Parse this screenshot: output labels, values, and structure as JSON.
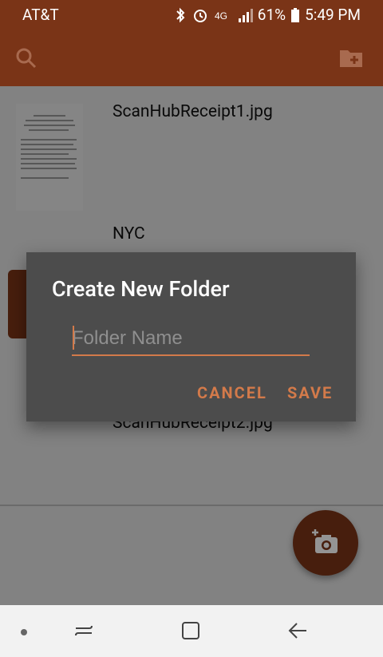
{
  "status_bar": {
    "carrier": "AT&T",
    "battery": "61%",
    "time": "5:49 PM",
    "icons": [
      "bluetooth-icon",
      "alarm-icon",
      "lte-icon",
      "signal-icon",
      "battery-icon"
    ]
  },
  "app_bar": {
    "actions": [
      "search-icon",
      "add-folder-icon"
    ]
  },
  "list": {
    "items": [
      {
        "name": "ScanHubReceipt1.jpg"
      },
      {
        "name": "NYC"
      },
      {
        "name": "ScanHubReceipt2.jpg"
      }
    ]
  },
  "dialog": {
    "title": "Create New Folder",
    "input": {
      "placeholder": "Folder Name",
      "value": ""
    },
    "cancel_label": "CANCEL",
    "save_label": "SAVE"
  },
  "fab": {
    "icon": "add-photo-icon"
  },
  "nav_bar": {
    "items": [
      "recent-dot-icon",
      "recents-icon",
      "home-icon",
      "back-icon"
    ]
  },
  "colors": {
    "brand": "#7a3417",
    "accent": "#d37a4a",
    "dialog_bg": "#4c4c4c"
  }
}
